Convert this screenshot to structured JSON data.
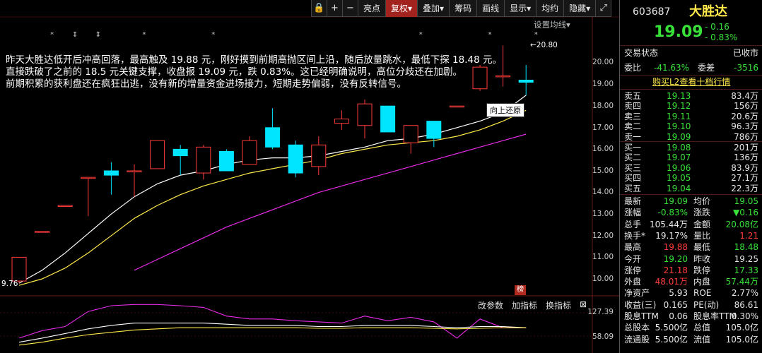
{
  "toolbar": {
    "items": [
      {
        "label": "",
        "icon": "lock-icon"
      },
      {
        "label": "+",
        "icon": "zoom-in-icon"
      },
      {
        "label": "−",
        "icon": "zoom-out-icon"
      },
      {
        "label": "亮点"
      },
      {
        "label": "复权",
        "active": true
      },
      {
        "label": "叠加"
      },
      {
        "label": "筹码"
      },
      {
        "label": "画线"
      },
      {
        "label": "显示"
      },
      {
        "label": "均约"
      },
      {
        "label": "隐藏"
      },
      {
        "label": "",
        "icon": "expand-icon"
      }
    ],
    "lock_glyph": "🔒",
    "zoom_in": "+",
    "zoom_out": "−",
    "highlight": "亮点",
    "adjust": "复权▾",
    "overlay": "叠加▾",
    "chips": "筹码",
    "draw": "画线",
    "display": "显示▾",
    "avg": "均约",
    "hide": "隐藏▾",
    "expand": "⤢"
  },
  "chart": {
    "setting_link": "设置均线▾",
    "annotation": [
      "昨天大胜达低开后冲高回落，最高触及 19.88 元，刚好摸到前期高抛区间上沿，随后放量跳水，最低下探 18.48 元。",
      "直接跌破了之前的 18.5 元关键支撑，收盘报 19.09 元，跌 0.83%。这已经明确说明，高位分歧还在加剧。",
      "前期积累的获利盘还在疯狂出逃，没有新的增量资金进场接力，短期走势偏弱，没有反转信号。"
    ],
    "tooltip": "向上还原",
    "high_label": "←20.80",
    "low_label": "9.76",
    "rank_badge": "榜",
    "price_ticks": [
      "20.00",
      "19.00",
      "18.00",
      "17.00",
      "16.00",
      "15.00",
      "14.00",
      "13.00",
      "12.00",
      "11.00",
      "10.00"
    ],
    "indicator_ticks": [
      "127.39",
      "58.09"
    ],
    "indicator_toolbar": [
      "改参数",
      "加指标",
      "换指标",
      "⊠"
    ],
    "colors": {
      "up": "#ff3c3c",
      "down": "#00e5ff",
      "ma5": "#ffffff",
      "ma10": "#ffe94a",
      "ma20": "#e62ce6"
    }
  },
  "chart_data": {
    "type": "candlestick",
    "ylim": [
      9.5,
      21
    ],
    "candles": [
      {
        "o": 9.9,
        "c": 11.0,
        "h": 11.0,
        "l": 9.8
      },
      {
        "o": 12.2,
        "c": 12.2,
        "h": 12.2,
        "l": 12.2
      },
      {
        "o": 13.4,
        "c": 13.4,
        "h": 13.4,
        "l": 13.4
      },
      {
        "o": 14.7,
        "c": 14.7,
        "h": 14.7,
        "l": 12.9
      },
      {
        "o": 15.0,
        "c": 14.8,
        "h": 15.4,
        "l": 13.9
      },
      {
        "o": 15.0,
        "c": 15.0,
        "h": 15.3,
        "l": 13.8
      },
      {
        "o": 15.1,
        "c": 16.4,
        "h": 16.4,
        "l": 15.1
      },
      {
        "o": 16.0,
        "c": 15.7,
        "h": 16.2,
        "l": 14.8
      },
      {
        "o": 14.9,
        "c": 16.1,
        "h": 16.2,
        "l": 14.6
      },
      {
        "o": 15.9,
        "c": 15.0,
        "h": 16.0,
        "l": 15.0
      },
      {
        "o": 15.3,
        "c": 16.4,
        "h": 16.6,
        "l": 15.3
      },
      {
        "o": 17.0,
        "c": 16.1,
        "h": 17.9,
        "l": 16.0
      },
      {
        "o": 16.2,
        "c": 14.9,
        "h": 16.4,
        "l": 14.7
      },
      {
        "o": 15.2,
        "c": 16.2,
        "h": 16.6,
        "l": 14.8
      },
      {
        "o": 17.2,
        "c": 17.4,
        "h": 17.8,
        "l": 16.9
      },
      {
        "o": 17.1,
        "c": 18.1,
        "h": 18.3,
        "l": 16.5
      },
      {
        "o": 18.0,
        "c": 16.8,
        "h": 18.0,
        "l": 16.8
      },
      {
        "o": 16.3,
        "c": 17.1,
        "h": 17.1,
        "l": 15.8
      },
      {
        "o": 17.3,
        "c": 16.5,
        "h": 17.3,
        "l": 16.1
      },
      {
        "o": 18.0,
        "c": 18.0,
        "h": 18.0,
        "l": 18.0
      },
      {
        "o": 18.8,
        "c": 19.8,
        "h": 19.9,
        "l": 18.7
      },
      {
        "o": 19.4,
        "c": 19.4,
        "h": 20.8,
        "l": 18.9
      },
      {
        "o": 19.2,
        "c": 19.1,
        "h": 19.9,
        "l": 18.5
      }
    ],
    "ma5": [
      9.8,
      10.4,
      11.2,
      12.1,
      13.0,
      13.8,
      14.4,
      14.8,
      15.0,
      15.3,
      15.5,
      15.6,
      15.6,
      15.7,
      15.9,
      16.1,
      16.4,
      16.5,
      16.7,
      17.0,
      17.3,
      17.7,
      18.5
    ],
    "ma10": [
      9.7,
      10.0,
      10.5,
      11.2,
      12.0,
      12.8,
      13.4,
      13.9,
      14.3,
      14.6,
      14.9,
      15.1,
      15.3,
      15.5,
      15.8,
      16.0,
      16.2,
      16.3,
      16.4,
      16.6,
      16.9,
      17.3,
      17.8
    ],
    "ma20": [
      null,
      null,
      null,
      null,
      null,
      10.4,
      10.9,
      11.4,
      11.9,
      12.4,
      12.8,
      13.2,
      13.6,
      14.0,
      14.3,
      14.6,
      14.9,
      15.2,
      15.5,
      15.8,
      16.1,
      16.4,
      16.7
    ],
    "indicator": {
      "magenta": [
        62,
        75,
        82,
        108,
        118,
        120,
        120,
        118,
        115,
        100,
        95,
        95,
        92,
        90,
        88,
        100,
        92,
        98,
        90,
        62,
        95,
        80,
        80
      ],
      "white": [
        55,
        62,
        70,
        78,
        84,
        88,
        88,
        88,
        88,
        86,
        84,
        84,
        84,
        82,
        82,
        84,
        84,
        84,
        82,
        80,
        82,
        82,
        80
      ],
      "yellow": [
        50,
        55,
        62,
        68,
        72,
        76,
        78,
        80,
        80,
        80,
        80,
        80,
        80,
        79,
        79,
        80,
        80,
        80,
        79,
        78,
        79,
        80,
        80
      ],
      "ylim": [
        40,
        135
      ]
    }
  },
  "stock": {
    "code": "603687",
    "name": "大胜达",
    "price": "19.09",
    "change": "- 0.16",
    "pct": "- 0.83%",
    "status_label": "交易状态",
    "status_value": "已收市",
    "weibi_label": "委比",
    "weibi": "-41.63%",
    "weicha_label": "委差",
    "weicha": "-3516",
    "l2_link": "购买L2查看十档行情",
    "sells": [
      {
        "label": "卖五",
        "price": "19.13",
        "vol": "83.4万"
      },
      {
        "label": "卖四",
        "price": "19.12",
        "vol": "156万"
      },
      {
        "label": "卖三",
        "price": "19.11",
        "vol": "20.6万"
      },
      {
        "label": "卖二",
        "price": "19.10",
        "vol": "96.3万"
      },
      {
        "label": "卖一",
        "price": "19.09",
        "vol": "786万"
      }
    ],
    "buys": [
      {
        "label": "买一",
        "price": "19.08",
        "vol": "201万"
      },
      {
        "label": "买二",
        "price": "19.07",
        "vol": "136万"
      },
      {
        "label": "买三",
        "price": "19.06",
        "vol": "83.9万"
      },
      {
        "label": "买四",
        "price": "19.05",
        "vol": "27.1万"
      },
      {
        "label": "买五",
        "price": "19.04",
        "vol": "22.3万"
      }
    ],
    "stats": [
      {
        "l1": "最新",
        "v1": "19.09",
        "c1": "green",
        "l2": "均价",
        "v2": "19.05",
        "c2": "green"
      },
      {
        "l1": "涨幅",
        "v1": "-0.83%",
        "c1": "green",
        "l2": "涨跌",
        "v2": "▼0.16",
        "c2": "green"
      },
      {
        "l1": "总手",
        "v1": "105.44万",
        "c1": "white",
        "l2": "金额",
        "v2": "20.08亿",
        "c2": "cyan"
      },
      {
        "l1": "换手*",
        "v1": "19.17%",
        "c1": "white",
        "l2": "量比",
        "v2": "1.21",
        "c2": "red"
      },
      {
        "l1": "最高",
        "v1": "19.88",
        "c1": "red",
        "l2": "最低",
        "v2": "18.48",
        "c2": "green"
      },
      {
        "l1": "今开",
        "v1": "19.20",
        "c1": "green",
        "l2": "昨收",
        "v2": "19.25",
        "c2": "white"
      },
      {
        "l1": "涨停",
        "v1": "21.18",
        "c1": "red",
        "l2": "跌停",
        "v2": "17.33",
        "c2": "green"
      },
      {
        "l1": "外盘",
        "v1": "48.01万",
        "c1": "red",
        "l2": "内盘",
        "v2": "57.44万",
        "c2": "green"
      },
      {
        "l1": "净资产",
        "v1": "5.93",
        "c1": "white",
        "l2": "ROE",
        "v2": "2.77%",
        "c2": "white"
      },
      {
        "l1": "收益(三)",
        "v1": "0.165",
        "c1": "white",
        "l2": "PE(动)",
        "v2": "86.61",
        "c2": "white"
      },
      {
        "l1": "股息TTM",
        "v1": "0.06",
        "c1": "white",
        "l2": "股息率TTM",
        "v2": "0.30%",
        "c2": "white"
      },
      {
        "l1": "总股本",
        "v1": "5.500亿",
        "c1": "white",
        "l2": "总值",
        "v2": "105.0亿",
        "c2": "white"
      },
      {
        "l1": "流通股",
        "v1": "5.500亿",
        "c1": "white",
        "l2": "流值",
        "v2": "105.0亿",
        "c2": "white"
      }
    ]
  }
}
